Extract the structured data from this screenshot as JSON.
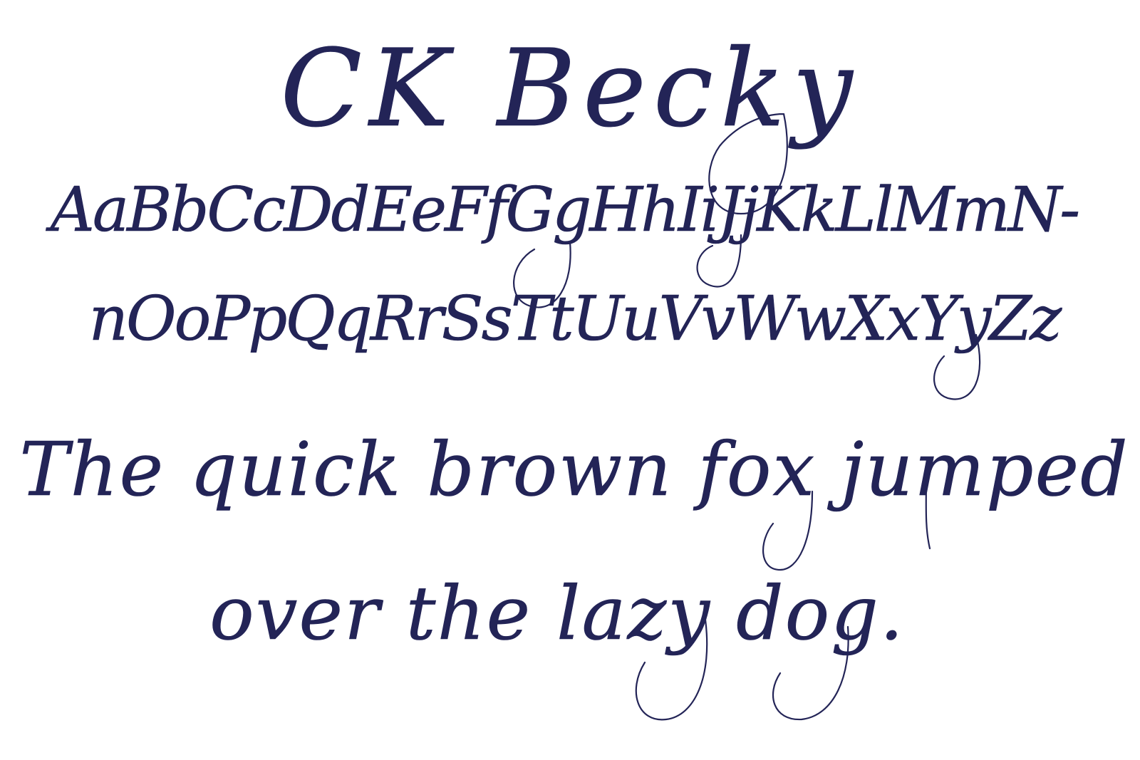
{
  "specimen": {
    "font_name": "CK Becky",
    "alphabet_line_1": "AaBbCcDdEeFfGgHhIiJjKkLlMmN-",
    "alphabet_line_2": "nOoPpQqRrSsTtUuVvWwXxYyZz",
    "pangram_line_1": "The quick brown fox jumped",
    "pangram_line_2": "over the lazy dog."
  },
  "colors": {
    "ink": "#232457",
    "paper": "#ffffff"
  }
}
